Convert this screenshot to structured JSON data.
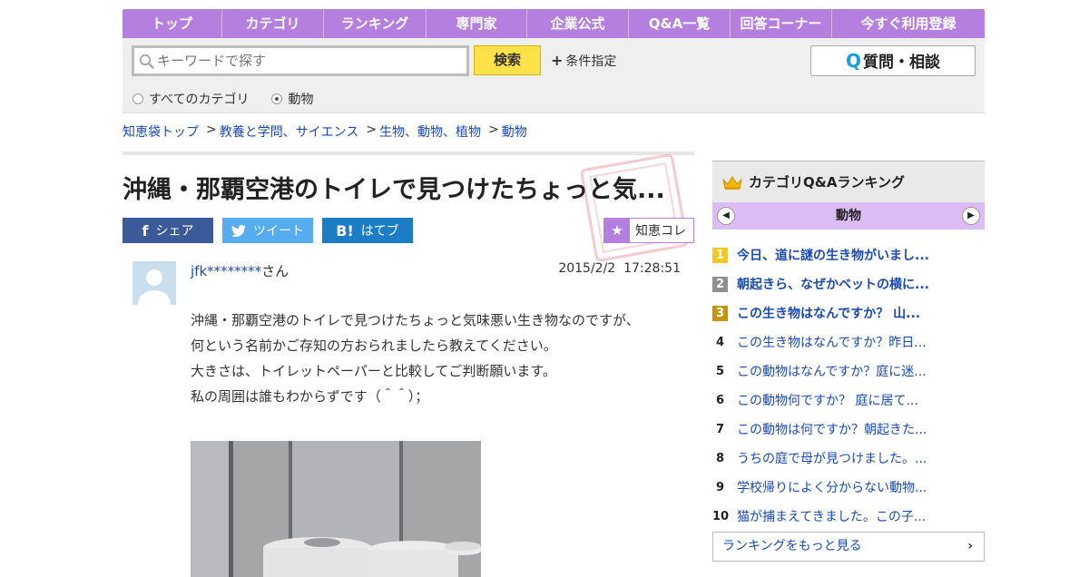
{
  "nav": {
    "items": [
      {
        "label": "トップ",
        "w": 110
      },
      {
        "label": "カテゴリ",
        "w": 112
      },
      {
        "label": "ランキング",
        "w": 113
      },
      {
        "label": "専門家",
        "w": 111
      },
      {
        "label": "企業公式",
        "w": 112
      },
      {
        "label": "Q&A一覧",
        "w": 112
      },
      {
        "label": "回答コーナー",
        "w": 112
      },
      {
        "label": "今すぐ利用登録",
        "w": 168
      }
    ]
  },
  "search": {
    "placeholder": "キーワードで探す",
    "button_label": "検索",
    "conditions_label": "条件指定",
    "ask_label": "質問・相談",
    "ask_icon": "Q",
    "radio_all": "すべてのカテゴリ",
    "radio_current": "動物"
  },
  "breadcrumb": [
    "知恵袋トップ",
    "教養と学問、サイエンス",
    "生物、動物、植物",
    "動物"
  ],
  "question": {
    "title": "沖縄・那覇空港のトイレで見つけたちょっと気...",
    "share_fb": "シェア",
    "share_tw": "ツイート",
    "share_hb": "はてブ",
    "chiekore_label": "知恵コレ",
    "user_name": "jfk********",
    "user_suffix": "さん",
    "date": "2015/2/2",
    "time": "17:28:51",
    "body_lines": [
      "沖縄・那覇空港のトイレで見つけたちょっと気味悪い生き物なのですが、",
      "何という名前かご存知の方おられましたら教えてください。",
      "大きさは、トイレットペーパーと比較してご判断願います。",
      "私の周囲は誰もわからずです（＾＾）；"
    ]
  },
  "sidebar": {
    "title": "カテゴリQ&Aランキング",
    "category": "動物",
    "ranking": [
      {
        "rank": "1",
        "text": "今日、道に謎の生き物がいまし..."
      },
      {
        "rank": "2",
        "text": "朝起きら、なぜかベットの横に..."
      },
      {
        "rank": "3",
        "text": "この生き物はなんですか？ 山..."
      },
      {
        "rank": "4",
        "text": "この生き物はなんですか？昨日..."
      },
      {
        "rank": "5",
        "text": "この動物はなんですか？庭に迷..."
      },
      {
        "rank": "6",
        "text": "この動物何ですか？ 庭に居て..."
      },
      {
        "rank": "7",
        "text": "この動物は何ですか？朝起きた..."
      },
      {
        "rank": "8",
        "text": "うちの庭で母が見つけました。..."
      },
      {
        "rank": "9",
        "text": "学校帰りによく分からない動物..."
      },
      {
        "rank": "10",
        "text": "猫が捕まえてきました。この子..."
      }
    ],
    "more_label": "ランキングをもっと見る"
  },
  "colors": {
    "nav": "#b57fe0",
    "link": "#1a4bb3",
    "search_button": "#ffe14a",
    "facebook": "#3b5a9a",
    "twitter": "#55acee",
    "hatena": "#1d7cc6"
  }
}
